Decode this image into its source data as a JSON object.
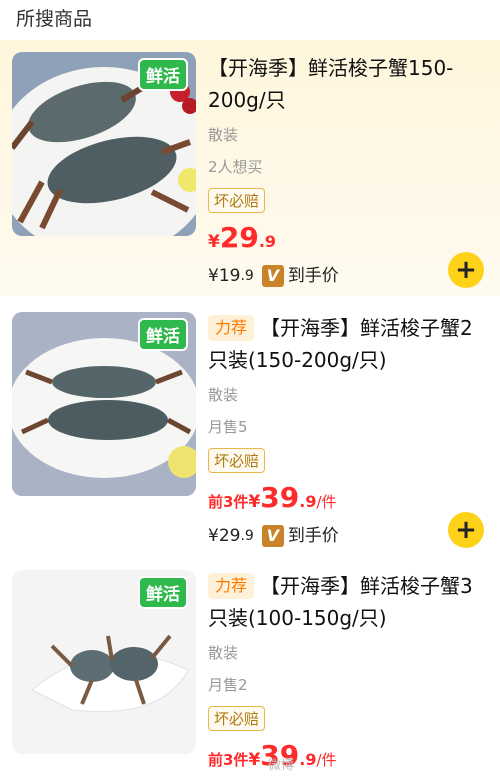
{
  "section": {
    "title": "所搜商品"
  },
  "products": [
    {
      "fresh_tag": "鲜活",
      "recommend": "",
      "title": "【开海季】鲜活梭子蟹150-200g/只",
      "pack": "散装",
      "stat": "2人想买",
      "badge": "坏必赔",
      "price_prefix": "",
      "price_currency": "¥",
      "price_int": "29",
      "price_dec": ".9",
      "price_suffix": "",
      "vip_price_int": "¥19",
      "vip_price_dec": ".9",
      "vip_icon": "V",
      "vip_label": "到手价",
      "add_label": "+"
    },
    {
      "fresh_tag": "鲜活",
      "recommend": "力荐",
      "title": "【开海季】鲜活梭子蟹2只装(150-200g/只)",
      "pack": "散装",
      "stat": "月售5",
      "badge": "坏必赔",
      "price_prefix": "前3件",
      "price_currency": "¥",
      "price_int": "39",
      "price_dec": ".9",
      "price_suffix": "/件",
      "vip_price_int": "¥29",
      "vip_price_dec": ".9",
      "vip_icon": "V",
      "vip_label": "到手价",
      "add_label": "+"
    },
    {
      "fresh_tag": "鲜活",
      "recommend": "力荐",
      "title": "【开海季】鲜活梭子蟹3只装(100-150g/只)",
      "pack": "散装",
      "stat": "月售2",
      "badge": "坏必赔",
      "price_prefix": "前3件",
      "price_currency": "¥",
      "price_int": "39",
      "price_dec": ".9",
      "price_suffix": "/件"
    }
  ],
  "watermark": "微博"
}
